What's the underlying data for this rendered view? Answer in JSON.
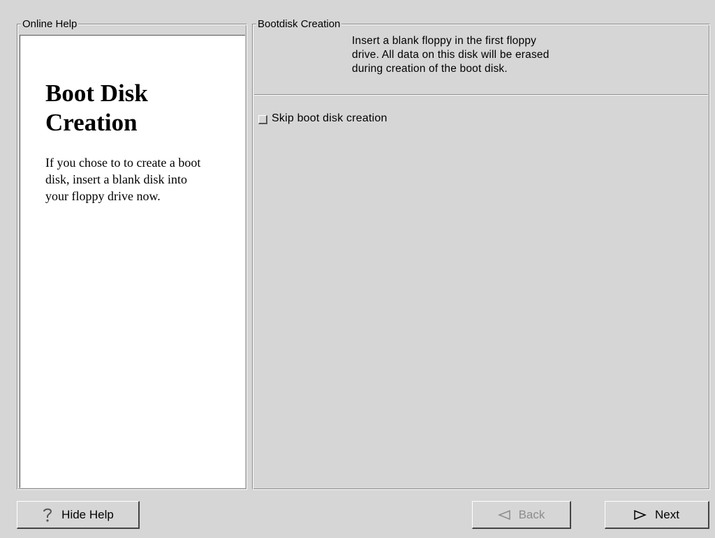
{
  "help": {
    "legend": "Online Help",
    "title": "Boot Disk Creation",
    "body": "If you chose to to create a boot disk, insert a blank disk into your floppy drive now."
  },
  "bootdisk": {
    "legend": "Bootdisk Creation",
    "instruction_lines": [
      "Insert a blank floppy in the first floppy",
      "drive. All data on this disk will be erased",
      "during creation of the boot disk."
    ],
    "skip_label": "Skip boot disk creation",
    "skip_checked": false
  },
  "buttons": {
    "hide_help": {
      "label": "Hide Help",
      "icon": "question-mark-icon"
    },
    "back": {
      "label": "Back",
      "icon": "left-arrow-icon",
      "enabled": false
    },
    "next": {
      "label": "Next",
      "icon": "right-arrow-icon",
      "enabled": true
    }
  }
}
